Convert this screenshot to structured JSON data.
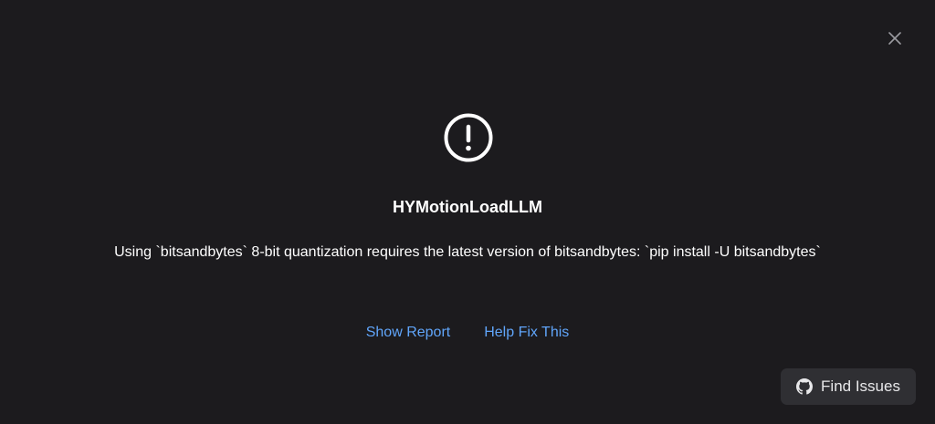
{
  "dialog": {
    "title": "HYMotionLoadLLM",
    "message": "Using `bitsandbytes` 8-bit quantization requires the latest version of bitsandbytes: `pip install -U bitsandbytes`",
    "icons": {
      "close": "close-icon",
      "alert": "exclamation-circle-icon",
      "github": "github-icon"
    },
    "links": {
      "show_report": "Show Report",
      "help_fix": "Help Fix This"
    },
    "find_issues_label": "Find Issues",
    "colors": {
      "background": "#1c1b1e",
      "text": "#ffffff",
      "link": "#60a5fa",
      "button_bg": "#2f2f33"
    }
  }
}
